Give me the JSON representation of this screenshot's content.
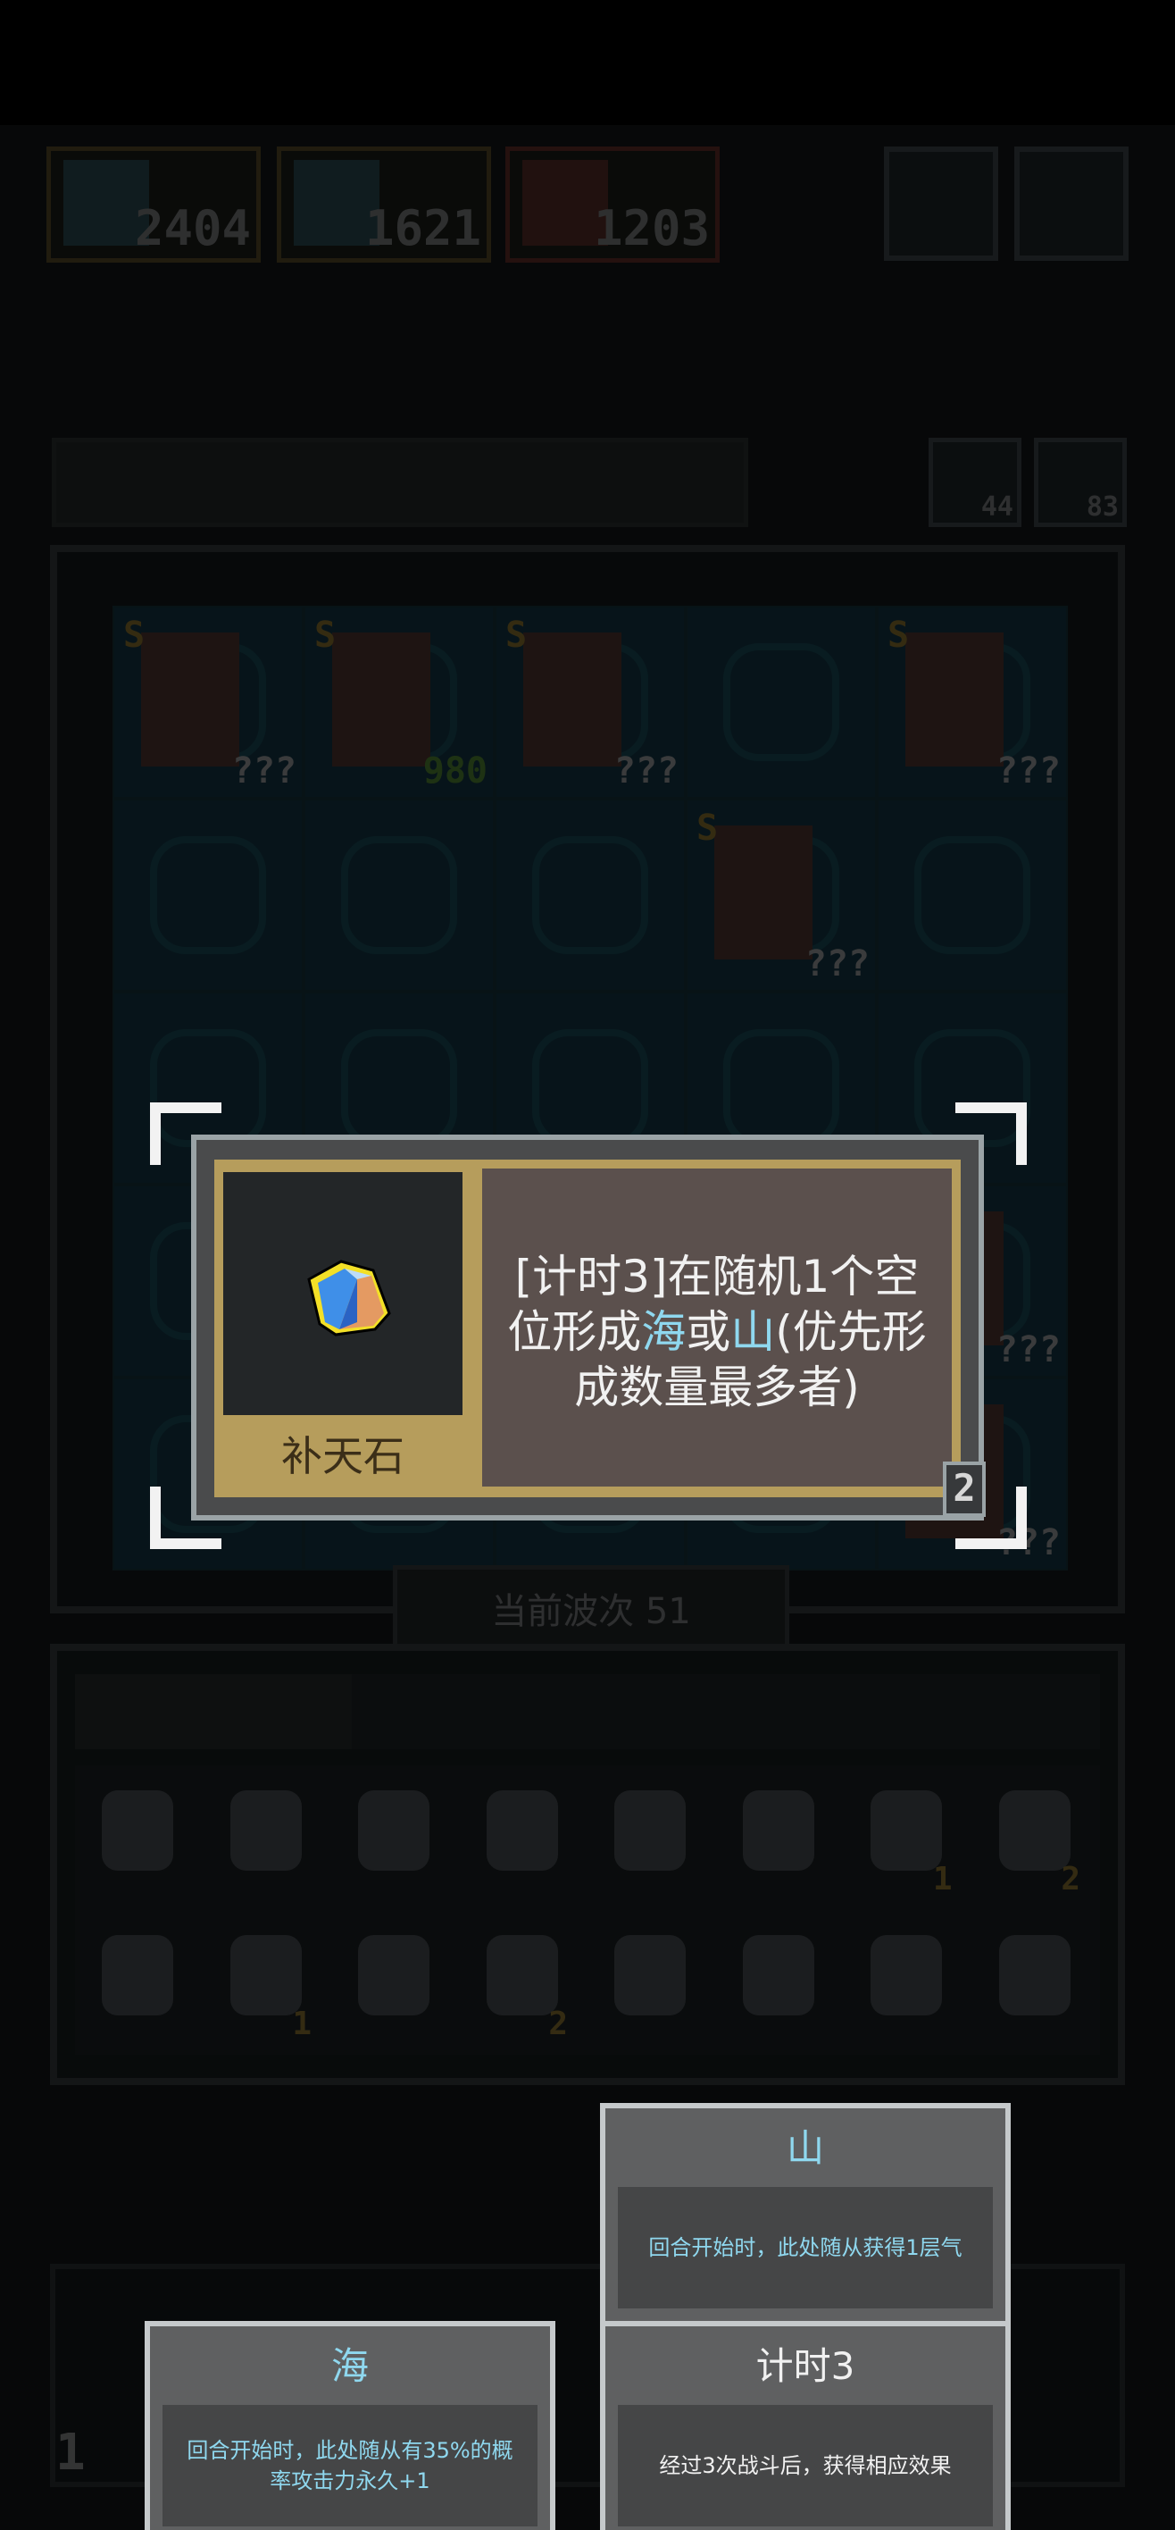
{
  "players": [
    {
      "score": "2404",
      "color": "#8a6a2a"
    },
    {
      "score": "1621",
      "color": "#8a6a2a"
    },
    {
      "score": "1203",
      "color": "#9a3a2a"
    }
  ],
  "resources": {
    "first": "44",
    "second": "83"
  },
  "board_units": [
    {
      "cell": 0,
      "rank": "S",
      "label": "???"
    },
    {
      "cell": 1,
      "rank": "S",
      "label": "980"
    },
    {
      "cell": 2,
      "rank": "S",
      "label": "???"
    },
    {
      "cell": 4,
      "rank": "S",
      "label": "???"
    },
    {
      "cell": 8,
      "rank": "S",
      "label": "???"
    },
    {
      "cell": 19,
      "rank": "",
      "label": "???"
    },
    {
      "cell": 24,
      "rank": "",
      "label": "???"
    }
  ],
  "wave": {
    "label": "当前波次 51"
  },
  "inventory": [
    {
      "badge": ""
    },
    {
      "badge": ""
    },
    {
      "badge": ""
    },
    {
      "badge": ""
    },
    {
      "badge": ""
    },
    {
      "badge": ""
    },
    {
      "badge": "1"
    },
    {
      "badge": "2"
    },
    {
      "badge": ""
    },
    {
      "badge": "1"
    },
    {
      "badge": ""
    },
    {
      "badge": "2"
    },
    {
      "badge": ""
    },
    {
      "badge": ""
    },
    {
      "badge": ""
    },
    {
      "badge": ""
    }
  ],
  "bottom": {
    "corner_number": "1"
  },
  "tooltip": {
    "item_name": "补天石",
    "desc_prefix": "[计时3]在随机1个空位形成",
    "kw_sea": "海",
    "desc_or": "或",
    "kw_mountain": "山",
    "desc_suffix": "(优先形成数量最多者)",
    "level": "2"
  },
  "keywords": {
    "mountain": {
      "title": "山",
      "body": "回合开始时，此处随从获得1层气"
    },
    "sea": {
      "title": "海",
      "body": "回合开始时，此处随从有35%的概率攻击力永久+1"
    },
    "timer": {
      "title": "计时3",
      "body": "经过3次战斗后，获得相应效果"
    }
  },
  "colors": {
    "keyword": "#8fd8ef",
    "gold": "#b69d5c",
    "panel": "#5b504d"
  }
}
